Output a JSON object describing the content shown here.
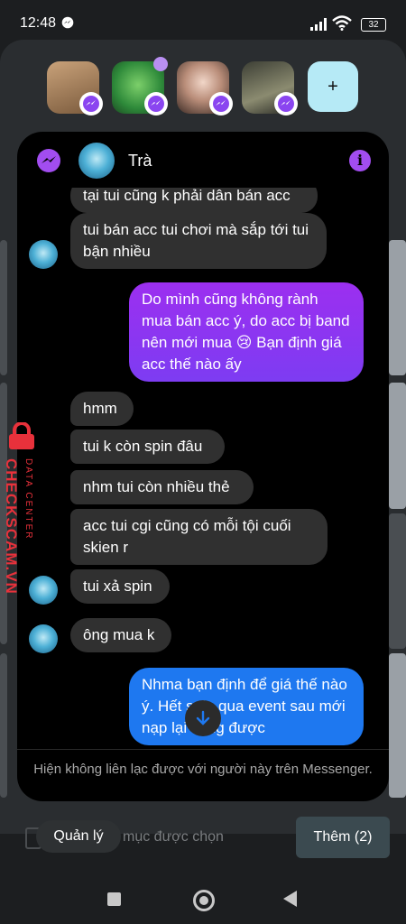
{
  "status_bar": {
    "time": "12:48",
    "battery": "32"
  },
  "chat_heads": {
    "add_label": "+"
  },
  "chat": {
    "contact_name": "Trà",
    "info_label": "i",
    "messages": [
      {
        "dir": "in",
        "text": "tại tui cũng k phải dân bán acc"
      },
      {
        "dir": "in",
        "text": "tui bán acc tui chơi mà sắp tới tui bận nhiều"
      },
      {
        "dir": "out",
        "text": "Do mình cũng không rành mua bán acc ý, do acc bị band nên mới mua 😢 Bạn định giá acc thế nào ấy"
      },
      {
        "dir": "in",
        "text": "hmm"
      },
      {
        "dir": "in",
        "text": "tui k còn spin đâu"
      },
      {
        "dir": "in",
        "text": "nhm tui còn nhiều thẻ"
      },
      {
        "dir": "in",
        "text": "acc tui cgi cũng có mỗi tội cuối skien r"
      },
      {
        "dir": "in",
        "text": "tui xả spin"
      },
      {
        "dir": "in",
        "text": "ông mua k"
      },
      {
        "dir": "out",
        "text": "Nhma bạn định để giá thế nào ý. Hết spin qua event sau mới nạp lại cũng được"
      }
    ],
    "footer_note": "Hiện không liên lạc được với người này trên Messenger."
  },
  "watermark": {
    "brand": "CHECKSCAM.VN",
    "sub": "DATA CENTER"
  },
  "bottom_bar": {
    "manage_label": "Quản lý",
    "selected_text": "mục được chọn",
    "add_label": "Thêm (2)"
  },
  "icons": [
    "messenger-icon",
    "info-icon",
    "arrow-down-icon",
    "plus-icon",
    "lock-icon",
    "nav-recents-icon",
    "nav-home-icon",
    "nav-back-icon",
    "wifi-icon",
    "signal-icon",
    "battery-icon"
  ],
  "colors": {
    "outgoing_bubble": "#8a36f0",
    "outgoing_bubble_blue": "#1e78f0",
    "incoming_bubble": "#303030",
    "accent_purple": "#a24df0",
    "plus_button": "#b6eaf6",
    "watermark_red": "#e8313b"
  }
}
